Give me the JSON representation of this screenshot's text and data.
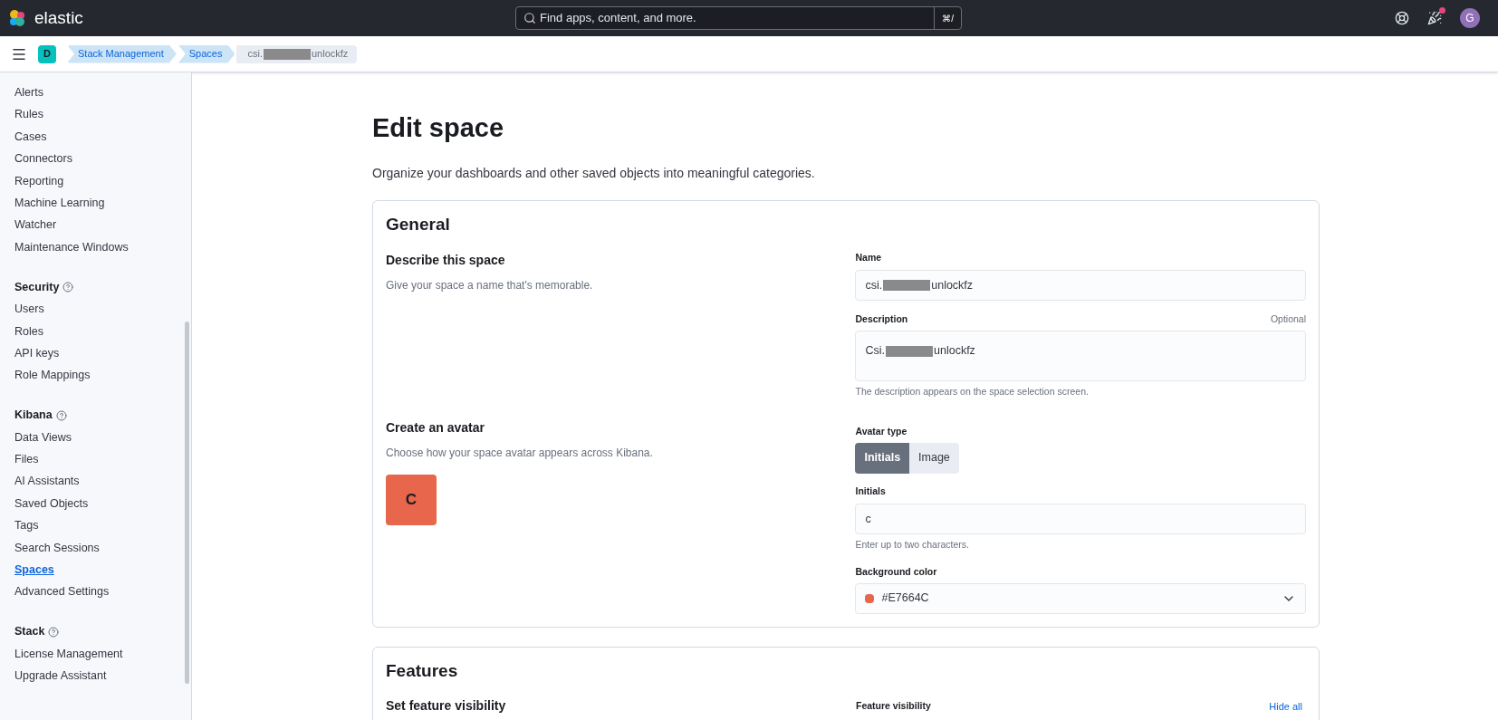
{
  "header": {
    "brand": "elastic",
    "search": {
      "placeholder": "Find apps, content, and more."
    },
    "shortcut": "⌘/",
    "user_initial": "G",
    "has_notification": true
  },
  "breadcrumb_bar": {
    "space_badge": "D",
    "crumbs": [
      {
        "text": "Stack Management",
        "kind": "link"
      },
      {
        "text": "Spaces",
        "kind": "link"
      },
      {
        "text": "csi.",
        "redacted_after": "unlockfz",
        "kind": "current"
      }
    ]
  },
  "sidebar": {
    "groups": [
      {
        "items": [
          {
            "label": "Alerts",
            "selected": false
          },
          {
            "label": "Rules",
            "selected": false
          },
          {
            "label": "Cases",
            "selected": false
          },
          {
            "label": "Connectors",
            "selected": false
          },
          {
            "label": "Reporting",
            "selected": false
          },
          {
            "label": "Machine Learning",
            "selected": false
          },
          {
            "label": "Watcher",
            "selected": false
          },
          {
            "label": "Maintenance Windows",
            "selected": false
          }
        ]
      },
      {
        "title": "Security",
        "items": [
          {
            "label": "Users",
            "selected": false
          },
          {
            "label": "Roles",
            "selected": false
          },
          {
            "label": "API keys",
            "selected": false
          },
          {
            "label": "Role Mappings",
            "selected": false
          }
        ]
      },
      {
        "title": "Kibana",
        "items": [
          {
            "label": "Data Views",
            "selected": false
          },
          {
            "label": "Files",
            "selected": false
          },
          {
            "label": "AI Assistants",
            "selected": false
          },
          {
            "label": "Saved Objects",
            "selected": false
          },
          {
            "label": "Tags",
            "selected": false
          },
          {
            "label": "Search Sessions",
            "selected": false
          },
          {
            "label": "Spaces",
            "selected": true
          },
          {
            "label": "Advanced Settings",
            "selected": false
          }
        ]
      },
      {
        "title": "Stack",
        "items": [
          {
            "label": "License Management",
            "selected": false
          },
          {
            "label": "Upgrade Assistant",
            "selected": false
          }
        ]
      }
    ]
  },
  "page": {
    "title": "Edit space",
    "subtitle": "Organize your dashboards and other saved objects into meaningful categories."
  },
  "general": {
    "title": "General",
    "describe": {
      "title": "Describe this space",
      "text": "Give your space a name that's memorable."
    },
    "name": {
      "label": "Name",
      "value_start": "csi.",
      "value_end": "unlockfz"
    },
    "description": {
      "label": "Description",
      "optional": "Optional",
      "value_start": "Csi.",
      "value_end": "unlockfz",
      "help": "The description appears on the space selection screen."
    },
    "avatar": {
      "title": "Create an avatar",
      "text": "Choose how your space avatar appears across Kibana.",
      "initials_shown": "C",
      "color": "#e7664c"
    },
    "avatar_type": {
      "label": "Avatar type",
      "options": [
        {
          "label": "Initials",
          "selected": true
        },
        {
          "label": "Image",
          "selected": false
        }
      ]
    },
    "initials": {
      "label": "Initials",
      "value": "c",
      "help": "Enter up to two characters."
    },
    "background_color": {
      "label": "Background color",
      "value": "#E7664C",
      "color": "#e7664c"
    }
  },
  "features": {
    "title": "Features",
    "subtitle": "Set feature visibility",
    "visibility_label": "Feature visibility",
    "hide_all": "Hide all"
  }
}
